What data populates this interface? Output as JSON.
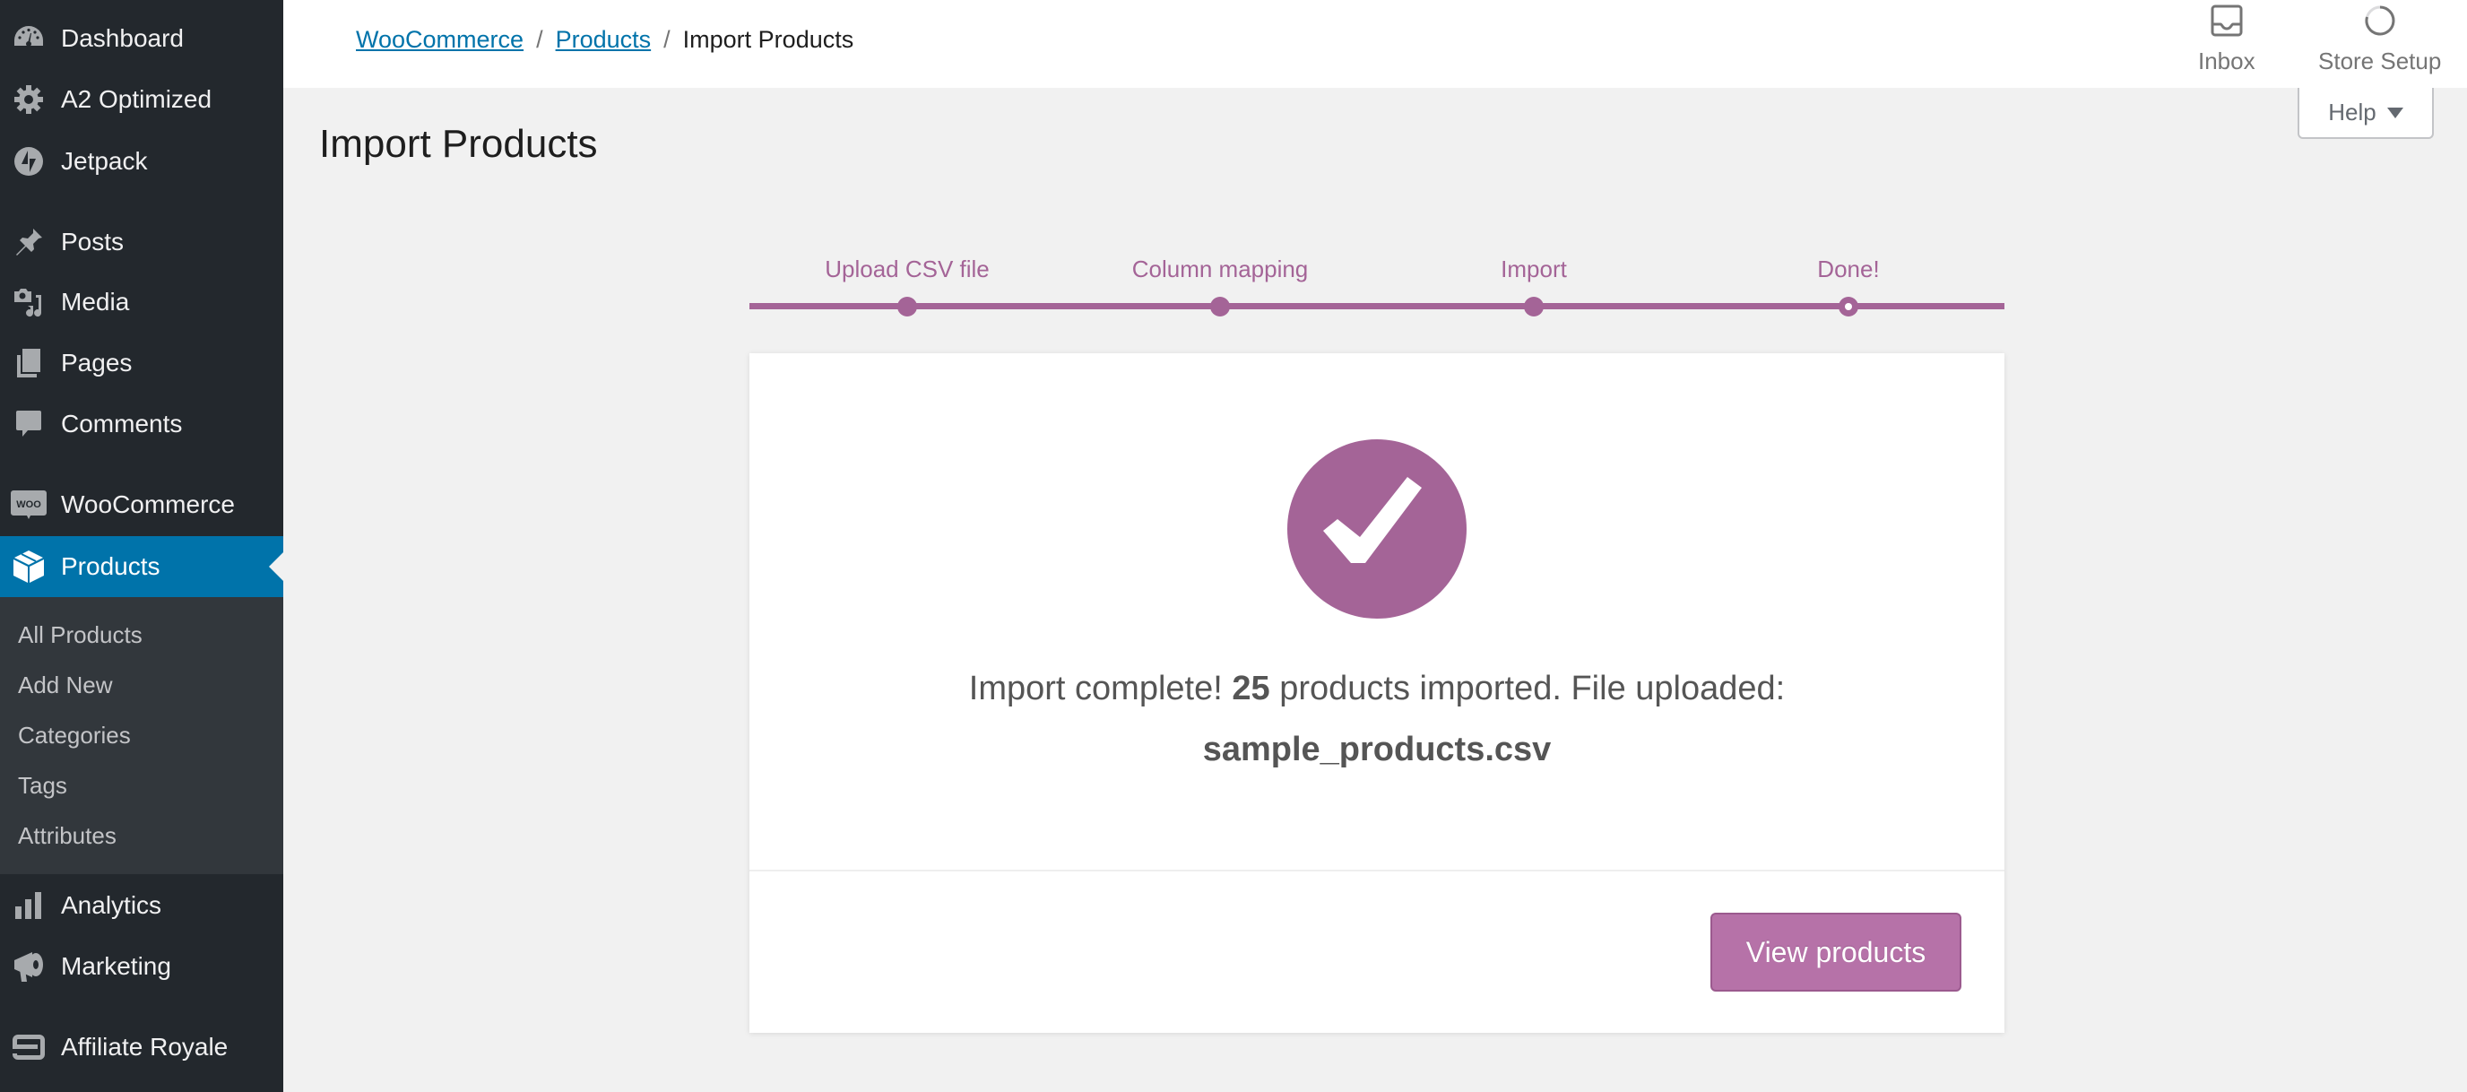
{
  "sidebar": {
    "items": [
      {
        "label": "Dashboard",
        "icon": "dashboard-icon"
      },
      {
        "label": "A2 Optimized",
        "icon": "gear-icon"
      },
      {
        "label": "Jetpack",
        "icon": "jetpack-icon"
      },
      {
        "label": "Posts",
        "icon": "pin-icon"
      },
      {
        "label": "Media",
        "icon": "media-icon"
      },
      {
        "label": "Pages",
        "icon": "pages-icon"
      },
      {
        "label": "Comments",
        "icon": "comment-icon"
      },
      {
        "label": "WooCommerce",
        "icon": "woo-icon"
      },
      {
        "label": "Products",
        "icon": "box-icon",
        "active": true
      },
      {
        "label": "Analytics",
        "icon": "bar-chart-icon"
      },
      {
        "label": "Marketing",
        "icon": "megaphone-icon"
      },
      {
        "label": "Affiliate Royale",
        "icon": "affiliate-royale-icon"
      }
    ],
    "submenu": [
      "All Products",
      "Add New",
      "Categories",
      "Tags",
      "Attributes"
    ]
  },
  "header": {
    "breadcrumb": [
      {
        "label": "WooCommerce",
        "link": true
      },
      {
        "label": "Products",
        "link": true
      },
      {
        "label": "Import Products",
        "link": false
      }
    ],
    "separator": "/",
    "actions": [
      {
        "label": "Inbox",
        "icon": "inbox-icon"
      },
      {
        "label": "Store Setup",
        "icon": "progress-ring-icon"
      }
    ]
  },
  "help": {
    "label": "Help"
  },
  "page": {
    "title": "Import Products"
  },
  "steps": {
    "items": [
      "Upload CSV file",
      "Column mapping",
      "Import",
      "Done!"
    ],
    "current_index": 3
  },
  "result": {
    "prefix": "Import complete!",
    "count": "25",
    "middle": "products imported. File uploaded:",
    "filename": "sample_products.csv",
    "button": "View products"
  },
  "colors": {
    "sidebar_bg": "#23282d",
    "submenu_bg": "#32373c",
    "active_blue": "#0073aa",
    "woo_purple": "#a46497",
    "button_purple": "#b672a8",
    "page_bg": "#f1f1f1"
  }
}
